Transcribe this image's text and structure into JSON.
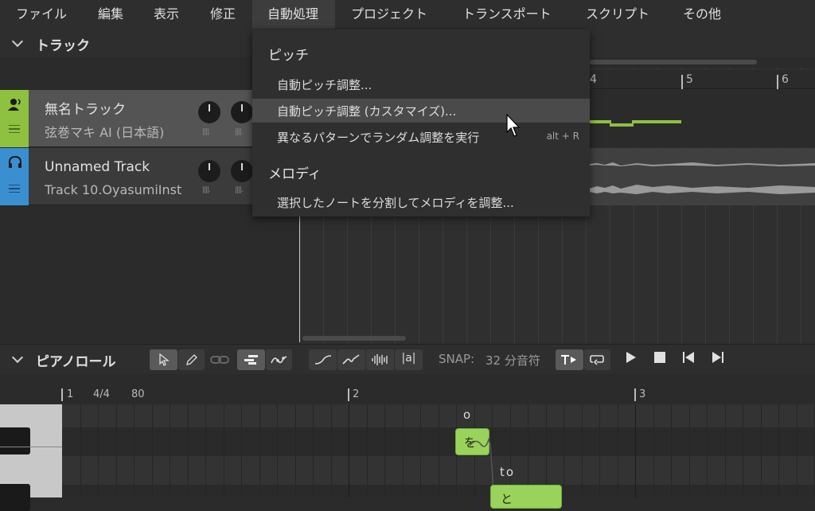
{
  "menubar": {
    "items": [
      "ファイル",
      "編集",
      "表示",
      "修正",
      "自動処理",
      "プロジェクト",
      "トランスポート",
      "スクリプト",
      "その他"
    ],
    "active_index": 4
  },
  "track_section": {
    "title": "トラック"
  },
  "ruler": {
    "bars": [
      "4",
      "5",
      "6"
    ]
  },
  "tracks": [
    {
      "name": "無名トラック",
      "voice": "弦巻マキ AI (日本語)",
      "color": "#8dc13f",
      "icon": "singer-icon"
    },
    {
      "name": "Unnamed Track",
      "voice": "Track 10.OyasumiInst",
      "color": "#3a8fd1",
      "icon": "headphones-icon"
    }
  ],
  "meter_glyph": "||||.",
  "pianoroll": {
    "title": "ピアノロール",
    "snap_label": "SNAP:",
    "snap_value": "32 分音符",
    "text_tool": "|a|",
    "ruler": {
      "bar1": "1",
      "time_sig": "4/4",
      "tempo": "80",
      "bar2": "2",
      "bar3": "3"
    },
    "notes": [
      {
        "lyric": "を",
        "phoneme": "o"
      },
      {
        "lyric": "と",
        "phoneme": "to"
      }
    ]
  },
  "dropdown": {
    "group_pitch": "ピッチ",
    "items_pitch": [
      {
        "label": "自動ピッチ調整...",
        "shortcut": ""
      },
      {
        "label": "自動ピッチ調整 (カスタマイズ)...",
        "shortcut": ""
      },
      {
        "label": "異なるパターンでランダム調整を実行",
        "shortcut": "alt + R"
      }
    ],
    "group_melody": "メロディ",
    "items_melody": [
      {
        "label": "選択したノートを分割してメロディを調整...",
        "shortcut": ""
      }
    ],
    "hovered_index": 1
  }
}
